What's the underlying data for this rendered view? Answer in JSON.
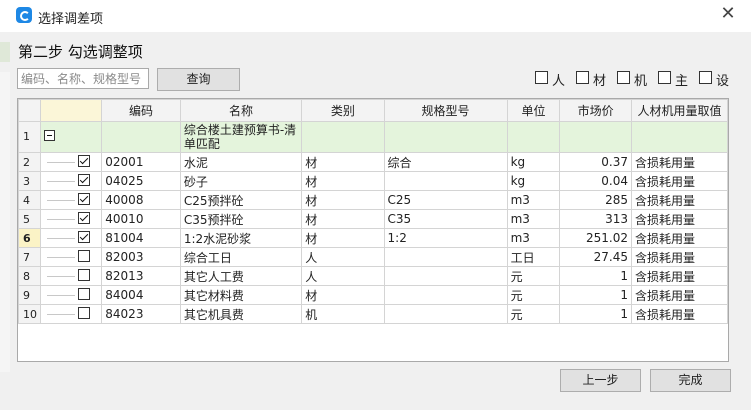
{
  "window": {
    "title": "选择调差项"
  },
  "step_title": "第二步 勾选调整项",
  "search": {
    "placeholder": "编码、名称、规格型号",
    "query_label": "查询"
  },
  "filters": [
    {
      "label": "人",
      "checked": false
    },
    {
      "label": "材",
      "checked": false
    },
    {
      "label": "机",
      "checked": false
    },
    {
      "label": "主",
      "checked": false
    },
    {
      "label": "设",
      "checked": false
    }
  ],
  "table": {
    "columns": [
      "",
      "",
      "编码",
      "名称",
      "类别",
      "规格型号",
      "单位",
      "市场价",
      "人材机用量取值"
    ],
    "group": {
      "row": "1",
      "name": "综合楼土建预算书-清单匹配"
    },
    "rows": [
      {
        "row": "2",
        "checked": true,
        "code": "02001",
        "name": "水泥",
        "category": "材",
        "spec": "综合",
        "unit": "kg",
        "price": "0.37",
        "usage": "含损耗用量"
      },
      {
        "row": "3",
        "checked": true,
        "code": "04025",
        "name": "砂子",
        "category": "材",
        "spec": "",
        "unit": "kg",
        "price": "0.04",
        "usage": "含损耗用量"
      },
      {
        "row": "4",
        "checked": true,
        "code": "40008",
        "name": "C25预拌砼",
        "category": "材",
        "spec": "C25",
        "unit": "m3",
        "price": "285",
        "usage": "含损耗用量"
      },
      {
        "row": "5",
        "checked": true,
        "code": "40010",
        "name": "C35预拌砼",
        "category": "材",
        "spec": "C35",
        "unit": "m3",
        "price": "313",
        "usage": "含损耗用量"
      },
      {
        "row": "6",
        "checked": true,
        "code": "81004",
        "name": "1:2水泥砂浆",
        "category": "材",
        "spec": "1:2",
        "unit": "m3",
        "price": "251.02",
        "usage": "含损耗用量",
        "active": true
      },
      {
        "row": "7",
        "checked": false,
        "code": "82003",
        "name": "综合工日",
        "category": "人",
        "spec": "",
        "unit": "工日",
        "price": "27.45",
        "usage": "含损耗用量"
      },
      {
        "row": "8",
        "checked": false,
        "code": "82013",
        "name": "其它人工费",
        "category": "人",
        "spec": "",
        "unit": "元",
        "price": "1",
        "usage": "含损耗用量"
      },
      {
        "row": "9",
        "checked": false,
        "code": "84004",
        "name": "其它材料费",
        "category": "材",
        "spec": "",
        "unit": "元",
        "price": "1",
        "usage": "含损耗用量"
      },
      {
        "row": "10",
        "checked": false,
        "code": "84023",
        "name": "其它机具费",
        "category": "机",
        "spec": "",
        "unit": "元",
        "price": "1",
        "usage": "含损耗用量"
      }
    ]
  },
  "buttons": {
    "prev": "上一步",
    "finish": "完成"
  }
}
